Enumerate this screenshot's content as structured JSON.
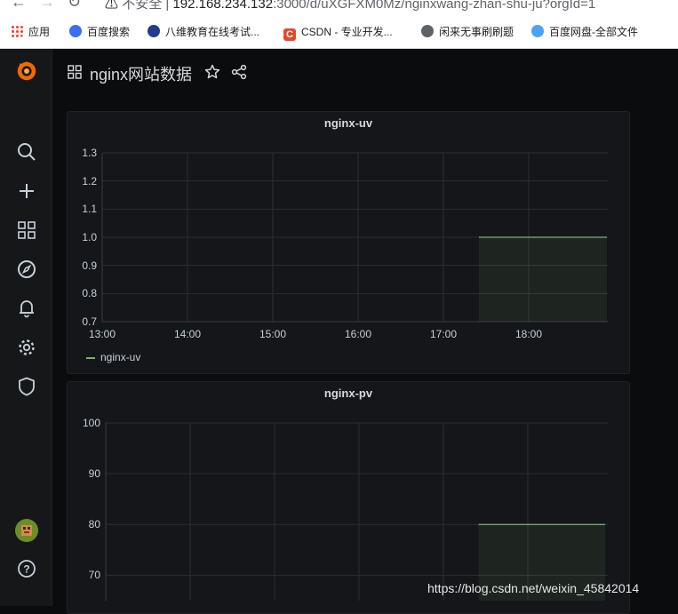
{
  "browser": {
    "url_warning": "不安全",
    "url_host": "192.168.234.132",
    "url_path": ":3000/d/uXGFXM0Mz/nginxwang-zhan-shu-ju?orgId=1",
    "bookmarks": [
      "应用",
      "百度搜索",
      "八维教育在线考试...",
      "CSDN - 专业开发...",
      "闲来无事刷刷题",
      "百度网盘-全部文件"
    ]
  },
  "dashboard": {
    "title": "nginx网站数据"
  },
  "sidebar": {
    "icons": [
      "grafana-logo-icon",
      "search-icon",
      "plus-icon",
      "dashboards-icon",
      "explore-icon",
      "alerting-bell-icon",
      "configuration-gear-icon",
      "shield-icon",
      "user-avatar-icon",
      "help-icon"
    ]
  },
  "chart_data": [
    {
      "type": "area",
      "title": "nginx-uv",
      "yticks": [
        "1.3",
        "1.2",
        "1.1",
        "1.0",
        "0.9",
        "0.8",
        "0.7"
      ],
      "xticks": [
        "13:00",
        "14:00",
        "15:00",
        "16:00",
        "17:00",
        "18:00"
      ],
      "ylim": [
        0.7,
        1.3
      ],
      "series": [
        {
          "name": "nginx-uv",
          "x_start": "17:25",
          "x_end": "18:55",
          "value": 1.0,
          "color": "#7eb26d"
        }
      ],
      "legend": "bottom-left",
      "grid": true
    },
    {
      "type": "area",
      "title": "nginx-pv",
      "yticks": [
        "100",
        "90",
        "80",
        "70"
      ],
      "ylim": [
        65,
        100
      ],
      "series": [
        {
          "x_start": "17:25",
          "x_end": "18:55",
          "value": 80,
          "color": "#7eb26d"
        }
      ],
      "grid": true
    }
  ],
  "watermark": "https://blog.csdn.net/weixin_45842014"
}
